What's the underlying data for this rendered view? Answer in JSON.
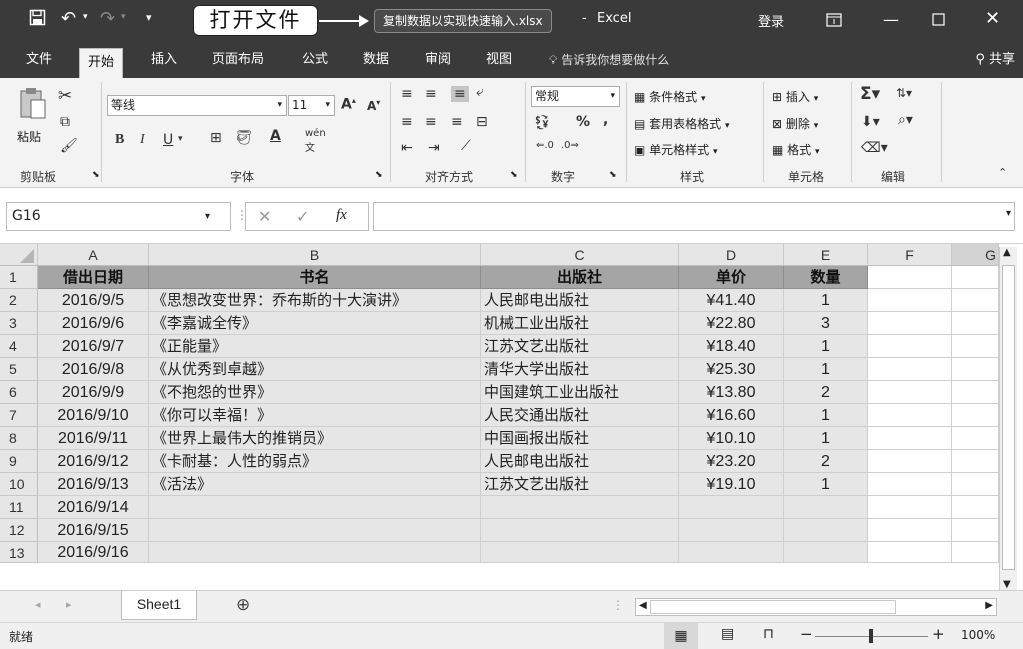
{
  "titlebar": {
    "callout": "打开文件",
    "filename": "复制数据以实现快速输入.xlsx",
    "app_sep": "-",
    "app_name": "Excel",
    "login": "登录"
  },
  "tabs": [
    "文件",
    "开始",
    "插入",
    "页面布局",
    "公式",
    "数据",
    "审阅",
    "视图"
  ],
  "tell_me": "告诉我你想要做什么",
  "share": "共享",
  "ribbon": {
    "paste": "粘贴",
    "clipboard": "剪贴板",
    "font_name": "等线",
    "font_size": "11",
    "font_group": "字体",
    "align_group": "对齐方式",
    "number_format": "常规",
    "number_group": "数字",
    "cond_format": "条件格式",
    "table_format": "套用表格格式",
    "cell_style": "单元格样式",
    "style_group": "样式",
    "insert": "插入",
    "delete": "删除",
    "format": "格式",
    "cells_group": "单元格",
    "edit_group": "编辑",
    "bold": "B",
    "italic": "I",
    "underline": "U",
    "percent": "%",
    "comma": ","
  },
  "formula": {
    "name_box": "G16",
    "fx": "fx"
  },
  "columns": [
    "A",
    "B",
    "C",
    "D",
    "E",
    "F",
    "G"
  ],
  "rows": [
    "1",
    "2",
    "3",
    "4",
    "5",
    "6",
    "7",
    "8",
    "9",
    "10",
    "11",
    "12",
    "13"
  ],
  "table": {
    "headers": [
      "借出日期",
      "书名",
      "出版社",
      "单价",
      "数量"
    ],
    "data": [
      [
        "2016/9/5",
        "《思想改变世界：乔布斯的十大演讲》",
        "人民邮电出版社",
        "¥41.40",
        "1"
      ],
      [
        "2016/9/6",
        "《李嘉诚全传》",
        "机械工业出版社",
        "¥22.80",
        "3"
      ],
      [
        "2016/9/7",
        "《正能量》",
        "江苏文艺出版社",
        "¥18.40",
        "1"
      ],
      [
        "2016/9/8",
        "《从优秀到卓越》",
        "清华大学出版社",
        "¥25.30",
        "1"
      ],
      [
        "2016/9/9",
        "《不抱怨的世界》",
        "中国建筑工业出版社",
        "¥13.80",
        "2"
      ],
      [
        "2016/9/10",
        "《你可以幸福！》",
        "人民交通出版社",
        "¥16.60",
        "1"
      ],
      [
        "2016/9/11",
        "《世界上最伟大的推销员》",
        "中国画报出版社",
        "¥10.10",
        "1"
      ],
      [
        "2016/9/12",
        "《卡耐基：人性的弱点》",
        "人民邮电出版社",
        "¥23.20",
        "2"
      ],
      [
        "2016/9/13",
        "《活法》",
        "江苏文艺出版社",
        "¥19.10",
        "1"
      ]
    ],
    "extra_dates": [
      "2016/9/14",
      "2016/9/15",
      "2016/9/16"
    ]
  },
  "sheet_tab": "Sheet1",
  "status": {
    "ready": "就绪",
    "zoom": "100%"
  },
  "colors": {
    "titlebar": "#3a3a3a",
    "header_fill": "#a5a5a5",
    "body_fill": "#e6e6e6"
  }
}
